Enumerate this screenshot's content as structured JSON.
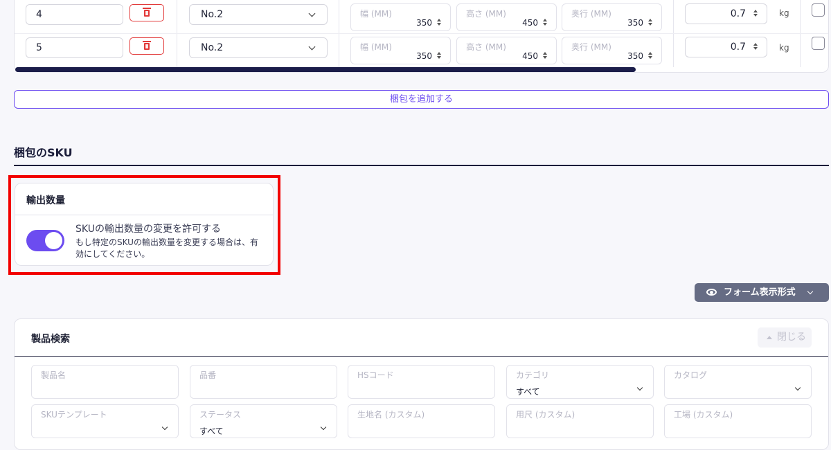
{
  "packages": {
    "rows": [
      {
        "qty": "4",
        "box": "No.2",
        "width_label": "幅 (MM)",
        "width": "350",
        "height_label": "高さ (MM)",
        "height": "450",
        "depth_label": "奥行 (MM)",
        "depth": "350",
        "weight": "0.7",
        "weight_unit": "kg"
      },
      {
        "qty": "5",
        "box": "No.2",
        "width_label": "幅 (MM)",
        "width": "350",
        "height_label": "高さ (MM)",
        "height": "450",
        "depth_label": "奥行 (MM)",
        "depth": "350",
        "weight": "0.7",
        "weight_unit": "kg"
      }
    ],
    "add_button": "梱包を追加する"
  },
  "sku_section": {
    "title": "梱包のSKU",
    "card_title": "輸出数量",
    "toggle_on": true,
    "toggle_title": "SKUの輸出数量の変更を許可する",
    "toggle_desc": "もし特定のSKUの輸出数量を変更する場合は、有効にしてください。"
  },
  "form_display_button": "フォーム表示形式",
  "product_search": {
    "title": "製品検索",
    "close_button": "閉じる",
    "fields": [
      {
        "label": "製品名",
        "value": ""
      },
      {
        "label": "品番",
        "value": ""
      },
      {
        "label": "HSコード",
        "value": ""
      },
      {
        "label": "カテゴリ",
        "value": "すべて"
      },
      {
        "label": "カタログ",
        "value": ""
      },
      {
        "label": "SKUテンプレート",
        "value": ""
      },
      {
        "label": "ステータス",
        "value": "すべて"
      },
      {
        "label": "生地名 (カスタム)",
        "value": ""
      },
      {
        "label": "用尺 (カスタム)",
        "value": ""
      },
      {
        "label": "工場 (カスタム)",
        "value": ""
      }
    ]
  },
  "colors": {
    "accent": "#6c4cf0",
    "danger": "#e23a3a",
    "highlight": "#f20000",
    "navy": "#1b1d3a"
  }
}
